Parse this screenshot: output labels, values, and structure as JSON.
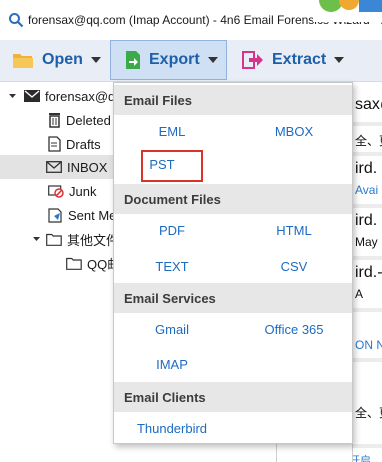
{
  "window": {
    "title": "forensax@qq.com (Imap Account) - 4n6 Email Forensics Wizard - ..."
  },
  "toolbar": {
    "open_label": "Open",
    "export_label": "Export",
    "extract_label": "Extract"
  },
  "tree": {
    "account": "forensax@q",
    "items": [
      "Deleted",
      "Drafts",
      "INBOX",
      "Junk",
      "Sent Me",
      "其他文件",
      "QQ邮"
    ]
  },
  "right_list": [
    "sax@q",
    "全、更",
    "ird.",
    "Avai",
    "ird.",
    "May",
    "ird.-",
    "A",
    "ON N",
    "全、更",
    "注册开启"
  ],
  "export_menu": {
    "sections": [
      {
        "title": "Email Files",
        "options": [
          "EML",
          "MBOX",
          "PST"
        ]
      },
      {
        "title": "Document Files",
        "options": [
          "PDF",
          "HTML",
          "TEXT",
          "CSV"
        ]
      },
      {
        "title": "Email Services",
        "options": [
          "Gmail",
          "Office 365",
          "IMAP"
        ]
      },
      {
        "title": "Email Clients",
        "options": [
          "Thunderbird"
        ]
      }
    ],
    "highlighted": "PST"
  },
  "colors": {
    "accent_blue": "#1d5fa8",
    "toolbar_bg": "#e9eef6",
    "highlight_red": "#d9342b"
  }
}
